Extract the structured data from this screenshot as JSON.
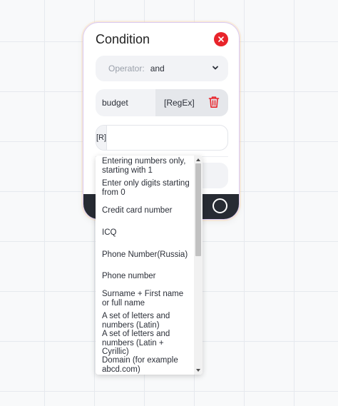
{
  "card": {
    "title": "Condition",
    "operator": {
      "label": "Operator:",
      "value": "and"
    },
    "field": {
      "name": "budget",
      "type": "[RegEx]"
    },
    "regex": {
      "prefix": "[R]",
      "value": ""
    }
  },
  "dropdown": {
    "items": [
      "Entering numbers only, starting with 1",
      "Enter only digits starting from 0",
      "Credit card number",
      "ICQ",
      "Phone Number(Russia)",
      "Phone number",
      "Surname + First name or full name",
      "A set of letters and numbers (Latin)",
      "A set of letters and numbers (Latin + Cyrillic)",
      "Domain (for example abcd.com)"
    ],
    "scroll_position": 0
  },
  "colors": {
    "accent_red": "#e8242b",
    "footer_dark": "#272b33",
    "field_bg": "#f2f3f6"
  },
  "icons": {
    "close": "close-icon",
    "chevron": "chevron-down-icon",
    "trash": "trash-icon",
    "ring": "circle-icon"
  }
}
